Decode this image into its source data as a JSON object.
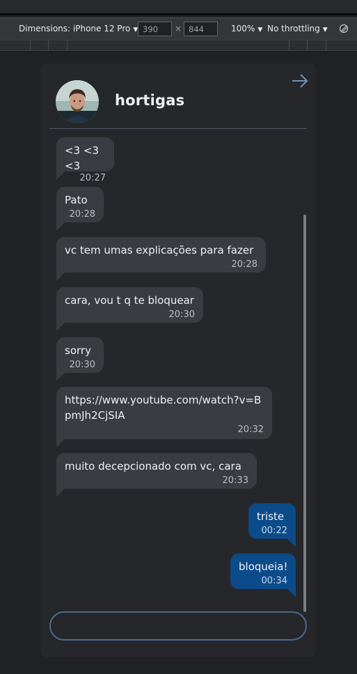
{
  "devtools": {
    "dimensions_label": "Dimensions: iPhone 12 Pro",
    "width_value": "390",
    "times_symbol": "×",
    "height_value": "844",
    "zoom": "100%",
    "throttling": "No throttling",
    "caret": "▼",
    "icons": [
      "rotate-icon"
    ]
  },
  "chat": {
    "contact_name": "hortigas",
    "icons": [
      "avatar-photo",
      "arrow-right-icon"
    ],
    "colors": {
      "incoming": "#3a3c41",
      "outgoing": "#0b4b8a",
      "input_border": "#4b6a8f"
    },
    "messages": [
      {
        "text": "<3 <3 <3",
        "time": "20:27",
        "direction": "in"
      },
      {
        "text": "Pato",
        "time": "20:28",
        "direction": "in"
      },
      {
        "text": "vc tem umas explicações para fazer",
        "time": "20:28",
        "direction": "in"
      },
      {
        "text": "cara, vou t q te bloquear",
        "time": "20:30",
        "direction": "in"
      },
      {
        "text": "sorry",
        "time": "20:30",
        "direction": "in"
      },
      {
        "text": "https://www.youtube.com/watch?v=BpmJh2CjSIA",
        "time": "20:32",
        "direction": "in"
      },
      {
        "text": "muito decepcionado com vc, cara",
        "time": "20:33",
        "direction": "in"
      },
      {
        "text": "triste",
        "time": "00:22",
        "direction": "out"
      },
      {
        "text": "bloqueia!",
        "time": "00:34",
        "direction": "out"
      }
    ],
    "input_placeholder": ""
  }
}
